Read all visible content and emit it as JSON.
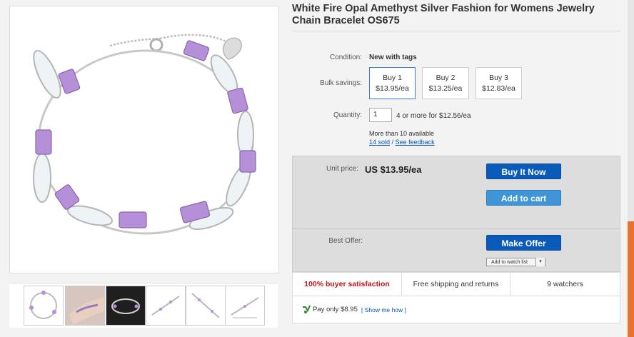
{
  "product": {
    "title": "White Fire Opal Amethyst Silver Fashion for Womens Jewelry Chain Bracelet OS675"
  },
  "details": {
    "condition_label": "Condition:",
    "condition_value": "New with tags",
    "bulk_label": "Bulk savings:",
    "bulk_options": [
      {
        "title": "Buy 1",
        "price": "$13.95/ea"
      },
      {
        "title": "Buy 2",
        "price": "$13.25/ea"
      },
      {
        "title": "Buy 3",
        "price": "$12.83/ea"
      }
    ],
    "quantity_label": "Quantity:",
    "quantity_value": "1",
    "quantity_note": "4 or more for $12.56/ea",
    "availability": "More than 10 available",
    "sold_link": "14 sold",
    "separator": "/",
    "feedback_link": "See feedback"
  },
  "buybox": {
    "unit_price_label": "Unit price:",
    "unit_price": "US $13.95/ea",
    "buy_now": "Buy It Now",
    "add_to_cart": "Add to cart",
    "best_offer_label": "Best Offer:",
    "make_offer": "Make Offer",
    "watch_list": "Add to watch list",
    "watch_caret": "▾"
  },
  "stats": {
    "satisfaction": "100% buyer satisfaction",
    "shipping": "Free shipping and returns",
    "watchers": "9 watchers"
  },
  "paypal": {
    "icon": "paypal-credit-icon",
    "text": "Pay only $8.95",
    "link": "[ Show me how ]"
  },
  "colors": {
    "primary_button": "#0a5aba",
    "secondary_button": "#3f95d5",
    "satisfaction_text": "#c4161c",
    "link": "#0654ba",
    "opal": "#e9f1f4",
    "amethyst": "#b58fd8",
    "silver": "#b8b8b8"
  },
  "thumbnails": [
    {
      "icon": "bracelet-circle-thumb"
    },
    {
      "icon": "bracelet-worn-thumb"
    },
    {
      "icon": "bracelet-dark-background-thumb"
    },
    {
      "icon": "bracelet-straight-thumb"
    },
    {
      "icon": "bracelet-diagonal-thumb"
    },
    {
      "icon": "bracelet-length-thumb"
    }
  ]
}
